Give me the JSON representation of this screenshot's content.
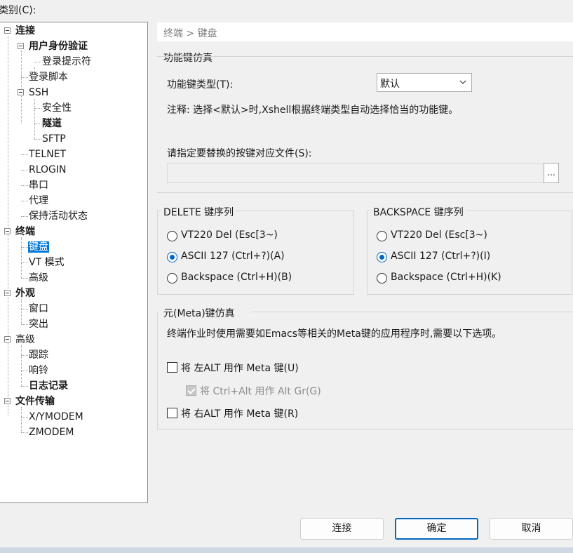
{
  "category_label": "类别(C):",
  "tree": [
    {
      "label": "连接",
      "bold": true
    },
    {
      "label": "用户身份验证",
      "bold": true
    },
    {
      "label": "登录提示符"
    },
    {
      "label": "登录脚本"
    },
    {
      "label": "SSH"
    },
    {
      "label": "安全性"
    },
    {
      "label": "隧道",
      "bold": true
    },
    {
      "label": "SFTP"
    },
    {
      "label": "TELNET"
    },
    {
      "label": "RLOGIN"
    },
    {
      "label": "串口"
    },
    {
      "label": "代理"
    },
    {
      "label": "保持活动状态"
    },
    {
      "label": "终端",
      "bold": true
    },
    {
      "label": "键盘",
      "selected": true
    },
    {
      "label": "VT 模式"
    },
    {
      "label": "高级"
    },
    {
      "label": "外观",
      "bold": true
    },
    {
      "label": "窗口"
    },
    {
      "label": "突出"
    },
    {
      "label": "高级"
    },
    {
      "label": "跟踪"
    },
    {
      "label": "响铃"
    },
    {
      "label": "日志记录",
      "bold": true
    },
    {
      "label": "文件传输",
      "bold": true
    },
    {
      "label": "X/YMODEM"
    },
    {
      "label": "ZMODEM"
    }
  ],
  "breadcrumb": "终端 > 键盘",
  "function_key": {
    "group_title": "功能键仿真",
    "type_label": "功能键类型(T):",
    "type_value": "默认",
    "note": "注释: 选择<默认>时,Xshell根据终端类型自动选择恰当的功能键。",
    "file_label": "请指定要替换的按键对应文件(S):",
    "file_value": "",
    "browse_label": "..."
  },
  "delete_seq": {
    "title": "DELETE 键序列",
    "options": [
      "VT220 Del (Esc[3~)",
      "ASCII 127 (Ctrl+?)(A)",
      "Backspace (Ctrl+H)(B)"
    ],
    "selected": 1
  },
  "backspace_seq": {
    "title": "BACKSPACE 键序列",
    "options": [
      "VT220 Del (Esc[3~)",
      "ASCII 127 (Ctrl+?)(I)",
      "Backspace (Ctrl+H)(K)"
    ],
    "selected": 1
  },
  "meta": {
    "title": "元(Meta)键仿真",
    "desc": "终端作业时使用需要如Emacs等相关的Meta键的应用程序时,需要以下选项。",
    "left_alt": "将 左ALT 用作 Meta 键(U)",
    "ctrl_alt": "将 Ctrl+Alt 用作 Alt Gr(G)",
    "right_alt": "将 右ALT 用作 Meta 键(R)"
  },
  "buttons": {
    "connect": "连接",
    "ok": "确定",
    "cancel": "取消"
  },
  "colors": {
    "selection": "#0078d7",
    "accent": "#0067c0"
  }
}
